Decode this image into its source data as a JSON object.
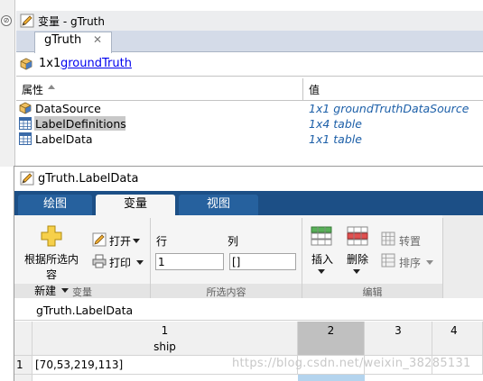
{
  "top_window": {
    "title": "变量 - gTruth",
    "tab_label": "gTruth",
    "tab_close": "✕",
    "info_size": "1x1",
    "info_class": "groundTruth",
    "column_property": "属性",
    "column_value": "值",
    "properties": [
      {
        "name": "DataSource",
        "value": "1x1 groundTruthDataSource",
        "icon": "object-icon"
      },
      {
        "name": "LabelDefinitions",
        "value": "1x4 table",
        "icon": "table-icon"
      },
      {
        "name": "LabelData",
        "value": "1x1 table",
        "icon": "table-icon"
      }
    ]
  },
  "bottom_window": {
    "title": "gTruth.LabelData",
    "ribbon_tabs": [
      "绘图",
      "变量",
      "视图"
    ],
    "active_tab": "变量",
    "new_from_selection": "根据所选内容\n新建",
    "open_label": "打开",
    "print_label": "打印",
    "row_label": "行",
    "col_label": "列",
    "row_value": "1",
    "col_value": "[]",
    "insert_label": "插入",
    "delete_label": "删除",
    "transpose_label": "转置",
    "sort_label": "排序",
    "group_variable": "变量",
    "group_selection": "所选内容",
    "group_edit": "编辑",
    "path": "gTruth.LabelData",
    "grid": {
      "columns": [
        {
          "num": "1",
          "name": "ship"
        },
        {
          "num": "2",
          "name": ""
        },
        {
          "num": "3",
          "name": ""
        },
        {
          "num": "4",
          "name": ""
        }
      ],
      "rows": [
        {
          "num": "1",
          "cells": [
            "[70,53,219,113]",
            "",
            "",
            ""
          ]
        }
      ],
      "selected_column": "2"
    },
    "watermark": "https://blog.csdn.net/weixin_38285131"
  },
  "colors": {
    "ribbon_dark": "#1c4f86",
    "ribbon_tab": "#26619e",
    "link": "#0000ee",
    "value_text": "#1c5fa8"
  }
}
